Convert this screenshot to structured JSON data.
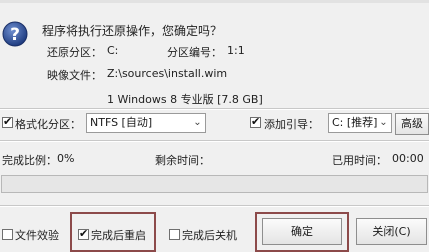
{
  "dialog": {
    "question": "程序将执行还原操作，您确定吗？",
    "restore_partition_label": "还原分区：",
    "restore_partition_value": "C:",
    "partition_number_label": "分区编号：",
    "partition_number_value": "1:1",
    "image_file_label": "映像文件：",
    "image_file_value": "Z:\\sources\\install.wim",
    "image_version_value": "1 Windows 8 专业版 [7.8 GB]"
  },
  "options": {
    "format_partition_label": "格式化分区：",
    "format_partition_checked": true,
    "filesystem_value": "NTFS [自动]",
    "add_boot_label": "添加引导：",
    "add_boot_checked": true,
    "boot_target_value": "C: [推荐]",
    "extra_button_label": "高级"
  },
  "progress": {
    "completion_label": "完成比例：",
    "completion_value": "0%",
    "remaining_label": "剩余时间：",
    "remaining_value": "",
    "elapsed_label": "已用时间：",
    "elapsed_value": "00:00",
    "fraction": 0
  },
  "footer": {
    "file_verify_label": "文件效验",
    "file_verify_checked": false,
    "restart_label": "完成后重启",
    "restart_checked": true,
    "shutdown_label": "完成后关机",
    "shutdown_checked": false,
    "ok_label": "确定",
    "close_label": "关闭(C)"
  },
  "colors": {
    "highlight_box": "#8c4a4a",
    "icon_blue": "#2f4f8f"
  }
}
